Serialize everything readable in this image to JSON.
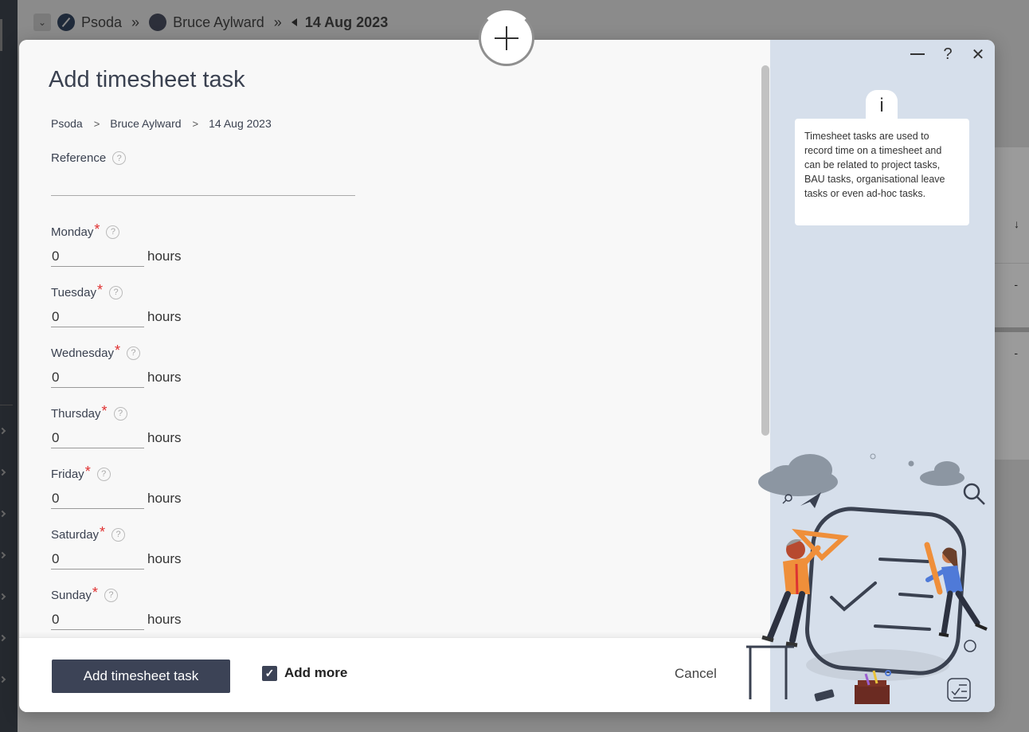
{
  "background": {
    "breadcrumb": {
      "org": "Psoda",
      "user": "Bruce Aylward",
      "date": "14 Aug 2023",
      "separator": "»"
    },
    "right_dashes": [
      "-",
      "-"
    ],
    "right_arrow": "↓"
  },
  "modal": {
    "title": "Add timesheet task",
    "breadcrumb": [
      "Psoda",
      "Bruce Aylward",
      "14 Aug 2023"
    ],
    "breadcrumb_separator": ">",
    "help_glyph": "?",
    "required_marker": "*",
    "reference": {
      "label": "Reference",
      "value": ""
    },
    "days": [
      {
        "label": "Monday",
        "value": "0",
        "unit": "hours"
      },
      {
        "label": "Tuesday",
        "value": "0",
        "unit": "hours"
      },
      {
        "label": "Wednesday",
        "value": "0",
        "unit": "hours"
      },
      {
        "label": "Thursday",
        "value": "0",
        "unit": "hours"
      },
      {
        "label": "Friday",
        "value": "0",
        "unit": "hours"
      },
      {
        "label": "Saturday",
        "value": "0",
        "unit": "hours"
      },
      {
        "label": "Sunday",
        "value": "0",
        "unit": "hours"
      }
    ],
    "footer": {
      "submit_label": "Add timesheet task",
      "add_more_label": "Add more",
      "add_more_checked": true,
      "cancel_label": "Cancel"
    }
  },
  "help_panel": {
    "info_glyph": "i",
    "text": "Timesheet tasks are used to record time on a timesheet and can be related to project tasks, BAU tasks, organisational leave tasks or even ad-hoc tasks.",
    "controls": {
      "help": "?",
      "close": "✕"
    }
  },
  "colors": {
    "primary": "#3c4356",
    "required": "#e03030",
    "panel_bg": "#d6dfeb"
  },
  "icons": [
    "add-icon",
    "minimize-icon",
    "help-icon",
    "close-icon",
    "info-icon",
    "checkmark-icon"
  ]
}
